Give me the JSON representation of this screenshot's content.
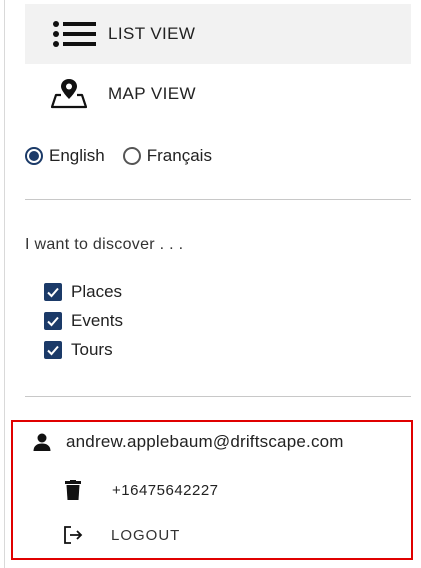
{
  "nav": {
    "list_view": {
      "label": "LIST VIEW",
      "icon": "list-icon"
    },
    "map_view": {
      "label": "MAP VIEW",
      "icon": "map-pin-icon"
    }
  },
  "language": {
    "options": [
      {
        "label": "English",
        "selected": true
      },
      {
        "label": "Français",
        "selected": false
      }
    ]
  },
  "discover": {
    "heading": "I want to discover . . .",
    "options": [
      {
        "label": "Places",
        "checked": true
      },
      {
        "label": "Events",
        "checked": true
      },
      {
        "label": "Tours",
        "checked": true
      }
    ]
  },
  "account": {
    "email": "andrew.applebaum@driftscape.com",
    "phone": "+16475642227",
    "logout_label": "LOGOUT",
    "icons": [
      "person-icon",
      "trash-icon",
      "logout-icon"
    ]
  },
  "colors": {
    "accent": "#1b3a68",
    "highlight_border": "#e00000",
    "active_bg": "#f2f2f2"
  }
}
